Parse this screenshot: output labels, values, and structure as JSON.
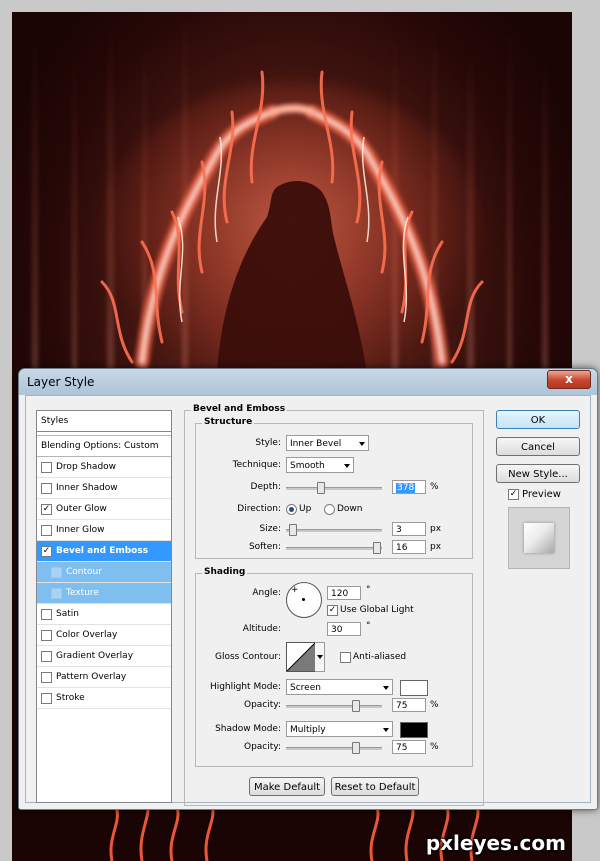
{
  "dialog": {
    "title": "Layer Style",
    "close_label": "x"
  },
  "styles_list": {
    "header": "Styles",
    "blending": "Blending Options: Custom",
    "items": [
      {
        "label": "Drop Shadow",
        "checked": false
      },
      {
        "label": "Inner Shadow",
        "checked": false
      },
      {
        "label": "Outer Glow",
        "checked": true
      },
      {
        "label": "Inner Glow",
        "checked": false
      },
      {
        "label": "Bevel and Emboss",
        "checked": true,
        "selected": true
      },
      {
        "label": "Contour",
        "checked": false,
        "sub": true
      },
      {
        "label": "Texture",
        "checked": false,
        "sub": true
      },
      {
        "label": "Satin",
        "checked": false
      },
      {
        "label": "Color Overlay",
        "checked": false
      },
      {
        "label": "Gradient Overlay",
        "checked": false
      },
      {
        "label": "Pattern Overlay",
        "checked": false
      },
      {
        "label": "Stroke",
        "checked": false
      }
    ]
  },
  "bevel": {
    "panel_title": "Bevel and Emboss",
    "structure": {
      "title": "Structure",
      "style_label": "Style:",
      "style_value": "Inner Bevel",
      "technique_label": "Technique:",
      "technique_value": "Smooth",
      "depth_label": "Depth:",
      "depth_value": "378",
      "depth_unit": "%",
      "depth_level": 0.35,
      "direction_label": "Direction:",
      "direction_up": "Up",
      "direction_down": "Down",
      "size_label": "Size:",
      "size_value": "3",
      "size_unit": "px",
      "size_level": 0.03,
      "soften_label": "Soften:",
      "soften_value": "16",
      "soften_unit": "px",
      "soften_level": 0.99
    },
    "shading": {
      "title": "Shading",
      "angle_label": "Angle:",
      "angle_value": "120",
      "angle_unit": "°",
      "use_global_light": "Use Global Light",
      "altitude_label": "Altitude:",
      "altitude_value": "30",
      "altitude_unit": "°",
      "gloss_label": "Gloss Contour:",
      "anti_aliased": "Anti-aliased",
      "highlight_label": "Highlight Mode:",
      "highlight_value": "Screen",
      "highlight_color": "#ffffff",
      "highlight_opacity_label": "Opacity:",
      "highlight_opacity": "75",
      "highlight_level": 0.75,
      "shadow_label": "Shadow Mode:",
      "shadow_value": "Multiply",
      "shadow_color": "#000000",
      "shadow_opacity_label": "Opacity:",
      "shadow_opacity": "75",
      "shadow_level": 0.75,
      "pct": "%"
    },
    "make_default": "Make Default",
    "reset_default": "Reset to Default"
  },
  "actions": {
    "ok": "OK",
    "cancel": "Cancel",
    "new_style": "New Style...",
    "preview": "Preview"
  },
  "watermark": "pxleyes.com"
}
